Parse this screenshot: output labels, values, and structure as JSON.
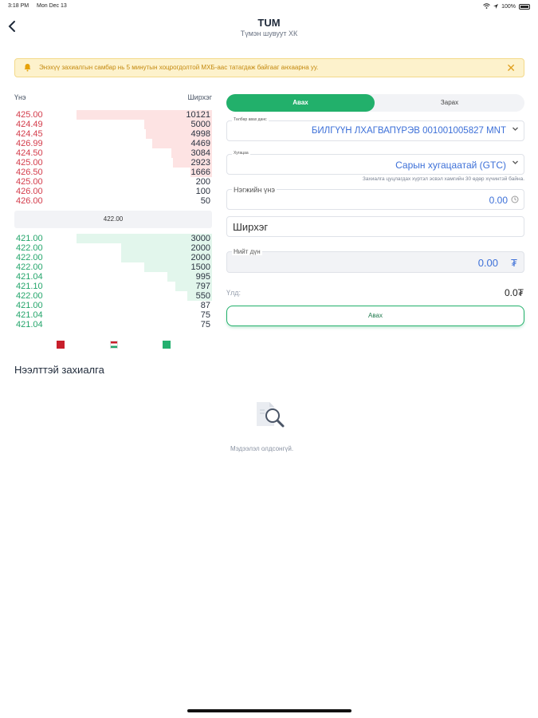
{
  "status_bar": {
    "time": "3:18 PM",
    "date": "Mon Dec 13",
    "battery": "100%"
  },
  "header": {
    "title": "TUM",
    "subtitle": "Түмэн шувуут ХК"
  },
  "banner": {
    "text": "Энэхүү захиалгын самбар нь 5 минутын хоцрогдолтой МХБ-аас татагдаж байгааг анхаарна уу."
  },
  "order_book": {
    "price_header": "Үнэ",
    "qty_header": "Ширхэг",
    "asks": [
      {
        "price": "425.00",
        "qty": "10121",
        "depth": 1.0
      },
      {
        "price": "424.49",
        "qty": "5000",
        "depth": 0.5
      },
      {
        "price": "424.45",
        "qty": "4998",
        "depth": 0.49
      },
      {
        "price": "426.99",
        "qty": "4469",
        "depth": 0.44
      },
      {
        "price": "424.50",
        "qty": "3084",
        "depth": 0.3
      },
      {
        "price": "425.00",
        "qty": "2923",
        "depth": 0.29
      },
      {
        "price": "426.50",
        "qty": "1666",
        "depth": 0.16
      },
      {
        "price": "425.00",
        "qty": "200",
        "depth": 0
      },
      {
        "price": "426.00",
        "qty": "100",
        "depth": 0
      },
      {
        "price": "426.00",
        "qty": "50",
        "depth": 0
      }
    ],
    "mid_price": "422.00",
    "bids": [
      {
        "price": "421.00",
        "qty": "3000",
        "depth": 1.0
      },
      {
        "price": "422.00",
        "qty": "2000",
        "depth": 0.67
      },
      {
        "price": "422.00",
        "qty": "2000",
        "depth": 0.67
      },
      {
        "price": "422.00",
        "qty": "1500",
        "depth": 0.5
      },
      {
        "price": "421.04",
        "qty": "995",
        "depth": 0.33
      },
      {
        "price": "421.10",
        "qty": "797",
        "depth": 0.27
      },
      {
        "price": "422.00",
        "qty": "550",
        "depth": 0.18
      },
      {
        "price": "421.00",
        "qty": "87",
        "depth": 0
      },
      {
        "price": "421.04",
        "qty": "75",
        "depth": 0
      },
      {
        "price": "421.04",
        "qty": "75",
        "depth": 0
      }
    ]
  },
  "open_orders": {
    "title": "Нээлттэй захиалга",
    "empty_text": "Мэдээлэл олдсонгүй."
  },
  "trade": {
    "tab_buy": "Авах",
    "tab_sell": "Зарах",
    "account_label": "Төлбөр авах данс",
    "account_value": "БИЛГҮҮН ЛХАГВАПҮРЭВ 001001005827 MNT",
    "term_label": "Хугацаа",
    "term_value": "Сарын хугацаатай (GTC)",
    "term_hint": "Захиалга цуцлагдах хүртэл эсвэл хамгийн 30 өдөр хүчинтэй байна.",
    "price_label": "Нэгжийн үнэ",
    "price_value": "0.00",
    "qty_placeholder": "Ширхэг",
    "total_label": "Нийт дүн",
    "total_value": "0.00",
    "currency_symbol": "₮",
    "balance_label": "Үлд:",
    "balance_value": "0.0₮",
    "submit_label": "Авах"
  },
  "colors": {
    "ask": "#d33b4a",
    "bid": "#24a56b",
    "accent": "#22b06b",
    "link": "#3d70d8"
  }
}
